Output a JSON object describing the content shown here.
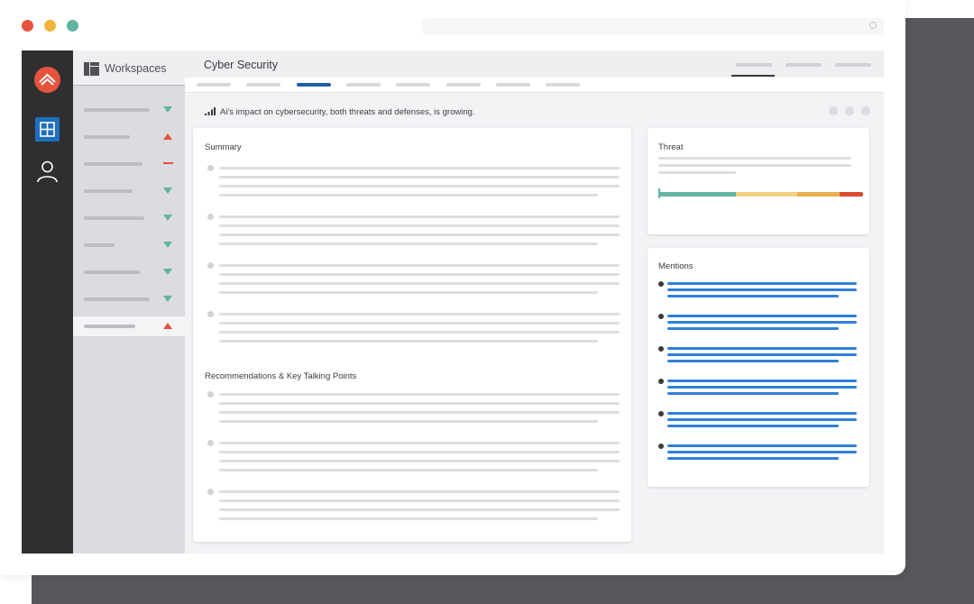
{
  "window": {
    "controls": [
      "close-dot",
      "minimize-dot",
      "maximize-dot"
    ]
  },
  "app": {
    "brand_icon": "mountain-logo-icon",
    "rail_items": [
      {
        "icon": "dashboard-icon",
        "active": true
      },
      {
        "icon": "user-icon",
        "active": false
      }
    ]
  },
  "sidebar": {
    "title": "Workspaces",
    "items": [
      {
        "trend": "down"
      },
      {
        "trend": "up"
      },
      {
        "trend": "flat"
      },
      {
        "trend": "down"
      },
      {
        "trend": "down"
      },
      {
        "trend": "down"
      },
      {
        "trend": "down"
      },
      {
        "trend": "down"
      },
      {
        "trend": "up",
        "selected": true
      }
    ]
  },
  "main": {
    "title": "Cyber Security",
    "insight": "Ai's impact on cybersecurity, both threats and defenses, is growing.",
    "summary": {
      "title": "Summary"
    },
    "recommendations": {
      "title": "Recommendations & Key Talking Points"
    },
    "threat": {
      "title": "Threat",
      "segments": [
        {
          "color": "#5fb5a2",
          "fraction": 0.375
        },
        {
          "color": "#f7cf85",
          "fraction": 0.3
        },
        {
          "color": "#e6b14d",
          "fraction": 0.21
        },
        {
          "color": "#db4a2e",
          "fraction": 0.115
        }
      ]
    },
    "mentions": {
      "title": "Mentions"
    }
  },
  "colors": {
    "accent": "#1f6fbf",
    "brand": "#e5533d",
    "positive": "#5fb5a2",
    "link": "#2f7fd8"
  }
}
